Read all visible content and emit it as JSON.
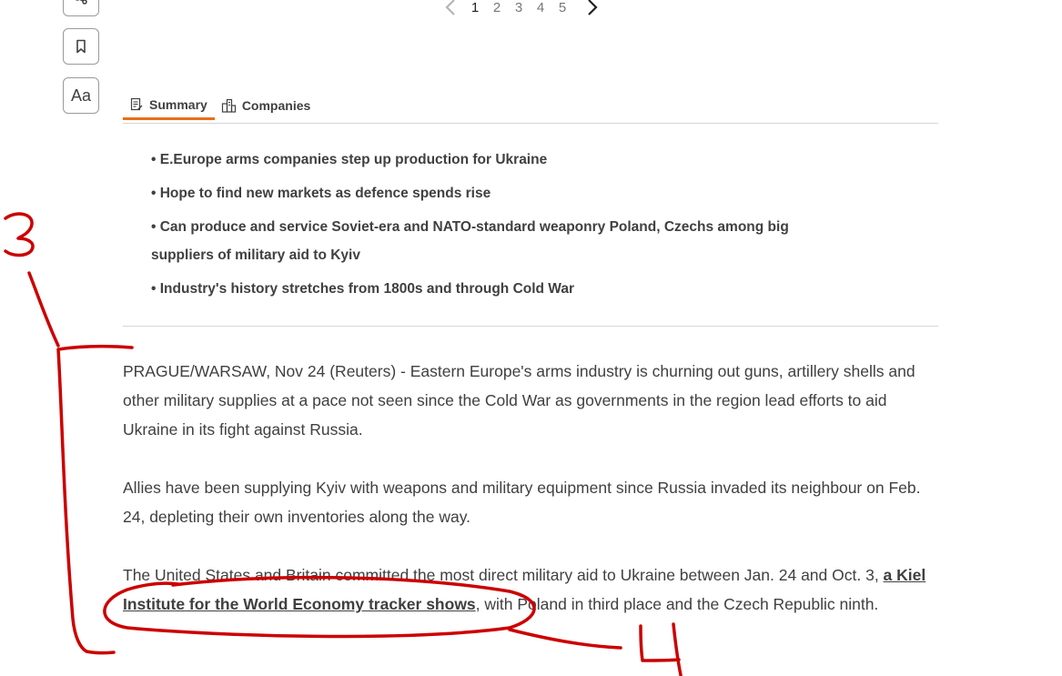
{
  "toolbar": {
    "share_icon": "share-icon",
    "bookmark_icon": "bookmark-icon",
    "text_size_label": "Aa"
  },
  "pagination": {
    "pages": [
      "1",
      "2",
      "3",
      "4",
      "5"
    ],
    "active": "1"
  },
  "tabs": [
    {
      "label": "Summary",
      "icon": "summary-icon",
      "active": true
    },
    {
      "label": "Companies",
      "icon": "companies-icon",
      "active": false
    }
  ],
  "summary": {
    "bullets": [
      "• E.Europe arms companies step up production for Ukraine",
      "• Hope to find new markets as defence spends rise",
      "• Can produce and service Soviet-era and NATO-standard weaponry Poland, Czechs among big suppliers of military aid to Kyiv",
      "• Industry's history stretches from 1800s and through Cold War"
    ]
  },
  "article": {
    "p1": "PRAGUE/WARSAW, Nov 24 (Reuters) - Eastern Europe's arms industry is churning out guns, artillery shells and other military supplies at a pace not seen since the Cold War as governments in the region lead efforts to aid Ukraine in its fight against Russia.",
    "p2": "Allies have been supplying Kyiv with weapons and military equipment since Russia invaded its neighbour on Feb. 24, depleting their own inventories along the way.",
    "p3_before": "The United States and Britain committed the most direct military aid to Ukraine between Jan. 24 and Oct. 3, ",
    "p3_link": "a Kiel Institute for the World Economy tracker shows",
    "p3_after": ", with Poland in third place and the Czech Republic ninth."
  },
  "annotations": {
    "label_3": "3",
    "label_4": "4",
    "ink_color": "#cc0000"
  },
  "colors": {
    "accent": "#e8701a",
    "text": "#404040",
    "divider": "#d6d6d6"
  }
}
